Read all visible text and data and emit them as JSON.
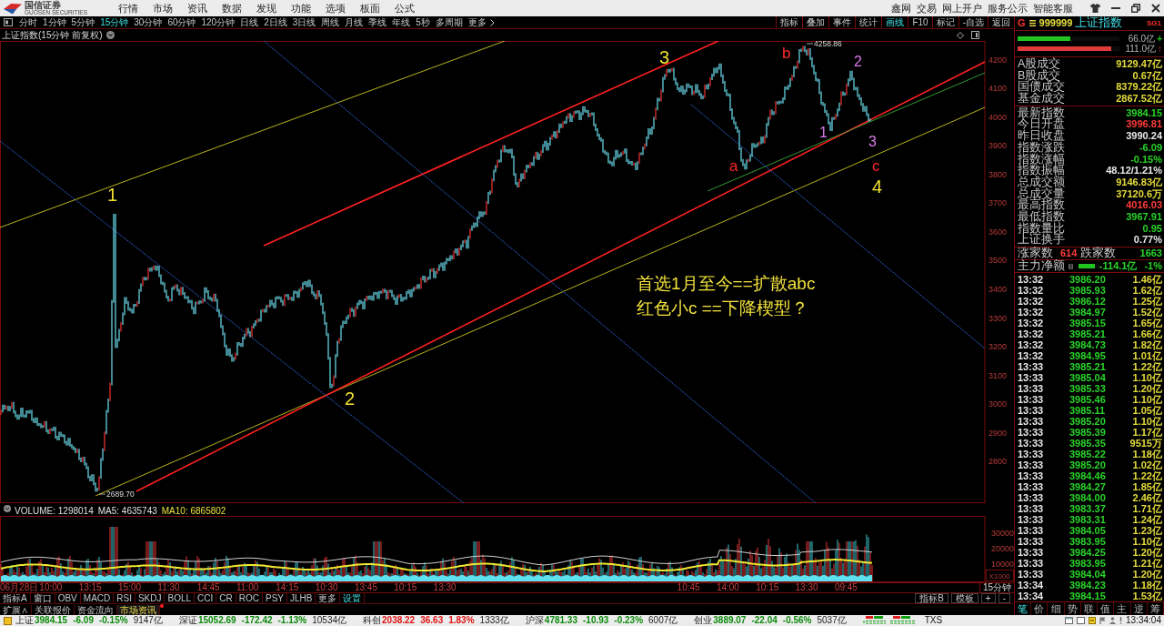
{
  "title_bar": {
    "logo_text": "国信证券",
    "logo_subtext": "GUOSEN SECURITIES",
    "menu": [
      "行情",
      "市场",
      "资讯",
      "数据",
      "发现",
      "功能",
      "选项",
      "板面",
      "公式"
    ],
    "links": [
      "鑫网",
      "交易",
      "网上开户",
      "服务公示",
      "智能客服"
    ]
  },
  "period_bar": {
    "periods": [
      {
        "label": "分时",
        "selected": false
      },
      {
        "label": "1分钟",
        "selected": false
      },
      {
        "label": "5分钟",
        "selected": false
      },
      {
        "label": "15分钟",
        "selected": true
      },
      {
        "label": "30分钟",
        "selected": false
      },
      {
        "label": "60分钟",
        "selected": false
      },
      {
        "label": "120分钟",
        "selected": false
      },
      {
        "label": "日线",
        "selected": false
      },
      {
        "label": "2日线",
        "selected": false
      },
      {
        "label": "3日线",
        "selected": false
      },
      {
        "label": "周线",
        "selected": false
      },
      {
        "label": "月线",
        "selected": false
      },
      {
        "label": "季线",
        "selected": false
      },
      {
        "label": "年线",
        "selected": false
      },
      {
        "label": "5秒",
        "selected": false
      },
      {
        "label": "多周期",
        "selected": false
      }
    ],
    "more": "更多",
    "tools": [
      {
        "label": "指标",
        "selected": false
      },
      {
        "label": "叠加",
        "selected": false
      },
      {
        "label": "事件",
        "selected": false
      },
      {
        "label": "统计",
        "selected": false
      },
      {
        "label": "画线",
        "selected": true
      },
      {
        "label": "F10",
        "selected": false
      },
      {
        "label": "标记",
        "selected": false
      },
      {
        "label": "-自选",
        "selected": false
      },
      {
        "label": "返回",
        "selected": false
      }
    ]
  },
  "chart": {
    "title": "上证指数(15分钟 前复权)",
    "price_axis": [
      "4200",
      "4100",
      "4000",
      "3900",
      "3800",
      "3700",
      "3600",
      "3500",
      "3400",
      "3300",
      "3200",
      "3100",
      "3000",
      "2900",
      "2800"
    ],
    "wave_labels": [
      {
        "text": "1",
        "color": "#f0e030"
      },
      {
        "text": "2",
        "color": "#f0e030"
      },
      {
        "text": "3",
        "color": "#f0e030"
      },
      {
        "text": "4",
        "color": "#f0e030"
      },
      {
        "text": "a",
        "color": "#ff2a2a"
      },
      {
        "text": "b",
        "color": "#ff2a2a"
      },
      {
        "text": "c",
        "color": "#ff2a2a"
      },
      {
        "text": "1",
        "color": "#d77ae8"
      },
      {
        "text": "2",
        "color": "#d77ae8"
      },
      {
        "text": "3",
        "color": "#d77ae8"
      }
    ],
    "high_mark": "4258.86",
    "low_mark": "2689.70",
    "notes": [
      "首选1月至今==扩散abc",
      "红色小c ==下降楔型？"
    ]
  },
  "volume": {
    "legend": [
      {
        "text": "VOLUME: 1298014",
        "color": "#e0e0e0"
      },
      {
        "text": "MA5: 4635743",
        "color": "#e0e0e0"
      },
      {
        "text": "MA10: 6865802",
        "color": "#e8e040"
      }
    ],
    "axis": [
      "30000",
      "20000",
      "10000"
    ],
    "unit": "X1000"
  },
  "time_axis": {
    "labels": [
      "06月28日",
      "10:00",
      "13:15",
      "15:00",
      "11:30",
      "14:45",
      "11:00",
      "14:15",
      "10:30",
      "13:45",
      "10:15",
      "13:30",
      "10:45",
      "14:00",
      "10:15",
      "13:30",
      "09:45"
    ],
    "period": "15分钟"
  },
  "indicator_bar": {
    "tabs": [
      {
        "label": "指标A",
        "kind": "indicator"
      },
      {
        "label": "窗口",
        "kind": "indicator"
      },
      {
        "label": "OBV",
        "kind": "indicator"
      },
      {
        "label": "MACD",
        "kind": "indicator"
      },
      {
        "label": "RSI",
        "kind": "indicator"
      },
      {
        "label": "SKDJ",
        "kind": "indicator"
      },
      {
        "label": "BOLL",
        "kind": "indicator"
      },
      {
        "label": "CCI",
        "kind": "indicator"
      },
      {
        "label": "CR",
        "kind": "indicator"
      },
      {
        "label": "ROC",
        "kind": "indicator"
      },
      {
        "label": "PSY",
        "kind": "indicator"
      },
      {
        "label": "JLHB",
        "kind": "indicator"
      },
      {
        "label": "更多",
        "kind": "indicator"
      },
      {
        "label": "设置",
        "kind": "action"
      }
    ],
    "tools": [
      "指标B",
      "模板",
      "+",
      "-"
    ]
  },
  "extension_bar": [
    {
      "label": "扩展∧",
      "selected": false,
      "alert": false
    },
    {
      "label": "关联报价",
      "selected": false,
      "alert": false
    },
    {
      "label": "资金流向",
      "selected": false,
      "alert": false
    },
    {
      "label": "市场资讯",
      "selected": true,
      "alert": true
    }
  ],
  "quote_panel": {
    "prefix": "G",
    "code": "999999",
    "name": "上证指数",
    "tag": "SG1",
    "flow_bars": [
      {
        "value": "66.0亿",
        "mark": "+",
        "level": 0.52,
        "color": "#22c422"
      },
      {
        "value": "111.0亿",
        "mark": "↑",
        "level": 0.92,
        "color": "#e03a3a"
      }
    ],
    "trade_stats": [
      {
        "label": "A股成交",
        "value": "9129.47亿",
        "color": "#e4dc3c"
      },
      {
        "label": "B股成交",
        "value": "0.67亿",
        "color": "#e4dc3c"
      },
      {
        "label": "国债成交",
        "value": "8379.22亿",
        "color": "#e4dc3c"
      },
      {
        "label": "基金成交",
        "value": "2867.52亿",
        "color": "#e4dc3c"
      }
    ],
    "index_stats": [
      {
        "label": "最新指数",
        "value": "3984.15",
        "color": "#2ad42a"
      },
      {
        "label": "今日开盘",
        "value": "3996.81",
        "color": "#ff3c3c"
      },
      {
        "label": "昨日收盘",
        "value": "3990.24",
        "color": "#e8e8e8"
      },
      {
        "label": "指数涨跌",
        "value": "-6.09",
        "color": "#2ad42a"
      },
      {
        "label": "指数涨幅",
        "value": "-0.15%",
        "color": "#2ad42a"
      },
      {
        "label": "指数振幅",
        "value": "48.12/1.21%",
        "color": "#e8e8e8"
      },
      {
        "label": "总成交额",
        "value": "9146.83亿",
        "color": "#e4dc3c"
      },
      {
        "label": "总成交量",
        "value": "37120.6万",
        "color": "#e4dc3c"
      },
      {
        "label": "最高指数",
        "value": "4016.03",
        "color": "#ff3c3c"
      },
      {
        "label": "最低指数",
        "value": "3967.91",
        "color": "#2ad42a"
      },
      {
        "label": "指数量比",
        "value": "0.95",
        "color": "#2ad42a"
      },
      {
        "label": "上证换手",
        "value": "0.77%",
        "color": "#e8e8e8"
      }
    ],
    "breadth": {
      "up_label": "涨家数",
      "up_value": "614",
      "down_label": "跌家数",
      "down_value": "1663"
    },
    "main_flow": {
      "label": "主力净额",
      "level": 0.8,
      "value": "-114.1亿",
      "percent": "-1%"
    },
    "ticks": [
      {
        "time": "13:32",
        "price": "3986.20",
        "volume": "1.46亿"
      },
      {
        "time": "13:32",
        "price": "3985.93",
        "volume": "1.62亿"
      },
      {
        "time": "13:32",
        "price": "3986.12",
        "volume": "1.25亿"
      },
      {
        "time": "13:32",
        "price": "3984.97",
        "volume": "1.52亿"
      },
      {
        "time": "13:32",
        "price": "3985.15",
        "volume": "1.65亿"
      },
      {
        "time": "13:32",
        "price": "3985.21",
        "volume": "1.66亿"
      },
      {
        "time": "13:32",
        "price": "3984.73",
        "volume": "1.82亿"
      },
      {
        "time": "13:32",
        "price": "3984.95",
        "volume": "1.01亿"
      },
      {
        "time": "13:33",
        "price": "3985.21",
        "volume": "1.22亿"
      },
      {
        "time": "13:33",
        "price": "3985.04",
        "volume": "1.10亿"
      },
      {
        "time": "13:33",
        "price": "3985.33",
        "volume": "1.20亿"
      },
      {
        "time": "13:33",
        "price": "3985.46",
        "volume": "1.10亿"
      },
      {
        "time": "13:33",
        "price": "3985.11",
        "volume": "1.05亿"
      },
      {
        "time": "13:33",
        "price": "3985.20",
        "volume": "1.10亿"
      },
      {
        "time": "13:33",
        "price": "3985.39",
        "volume": "1.17亿"
      },
      {
        "time": "13:33",
        "price": "3985.35",
        "volume": "9515万"
      },
      {
        "time": "13:33",
        "price": "3985.22",
        "volume": "1.18亿"
      },
      {
        "time": "13:33",
        "price": "3985.20",
        "volume": "1.02亿"
      },
      {
        "time": "13:33",
        "price": "3984.46",
        "volume": "1.22亿"
      },
      {
        "time": "13:33",
        "price": "3984.27",
        "volume": "1.85亿"
      },
      {
        "time": "13:33",
        "price": "3984.00",
        "volume": "2.46亿"
      },
      {
        "time": "13:33",
        "price": "3983.37",
        "volume": "1.71亿"
      },
      {
        "time": "13:33",
        "price": "3983.31",
        "volume": "1.24亿"
      },
      {
        "time": "13:33",
        "price": "3984.05",
        "volume": "1.23亿"
      },
      {
        "time": "13:33",
        "price": "3983.95",
        "volume": "1.10亿"
      },
      {
        "time": "13:33",
        "price": "3984.25",
        "volume": "1.20亿"
      },
      {
        "time": "13:33",
        "price": "3983.95",
        "volume": "1.21亿"
      },
      {
        "time": "13:33",
        "price": "3984.04",
        "volume": "1.20亿"
      },
      {
        "time": "13:34",
        "price": "3984.23",
        "volume": "1.18亿"
      },
      {
        "time": "13:34",
        "price": "3984.15",
        "volume": "1.53亿"
      }
    ],
    "tabs": [
      {
        "label": "笔",
        "selected": true
      },
      {
        "label": "价",
        "selected": false
      },
      {
        "label": "细",
        "selected": false
      },
      {
        "label": "势",
        "selected": false
      },
      {
        "label": "联",
        "selected": false
      },
      {
        "label": "值",
        "selected": false
      },
      {
        "label": "主",
        "selected": false
      },
      {
        "label": "逆",
        "selected": false
      },
      {
        "label": "筹",
        "selected": false
      }
    ]
  },
  "status_bar": {
    "indices": [
      {
        "name": "上证",
        "value": "3984.15",
        "change": "-6.09",
        "percent": "-0.15%",
        "amount": "9147亿",
        "color": "#0c8a0c"
      },
      {
        "name": "深证",
        "value": "15052.69",
        "change": "-172.42",
        "percent": "-1.13%",
        "amount": "10534亿",
        "color": "#0c8a0c"
      },
      {
        "name": "科创",
        "value": "2038.22",
        "change": "36.63",
        "percent": "1.83%",
        "amount": "1333亿",
        "color": "#e01414"
      },
      {
        "name": "沪深",
        "value": "4781.33",
        "change": "-10.93",
        "percent": "-0.23%",
        "amount": "6007亿",
        "color": "#0c8a0c"
      },
      {
        "name": "创业",
        "value": "3889.07",
        "change": "-22.04",
        "percent": "-0.56%",
        "amount": "5037亿",
        "color": "#0c8a0c"
      }
    ],
    "label": "TXS",
    "time": "13:34:04"
  }
}
